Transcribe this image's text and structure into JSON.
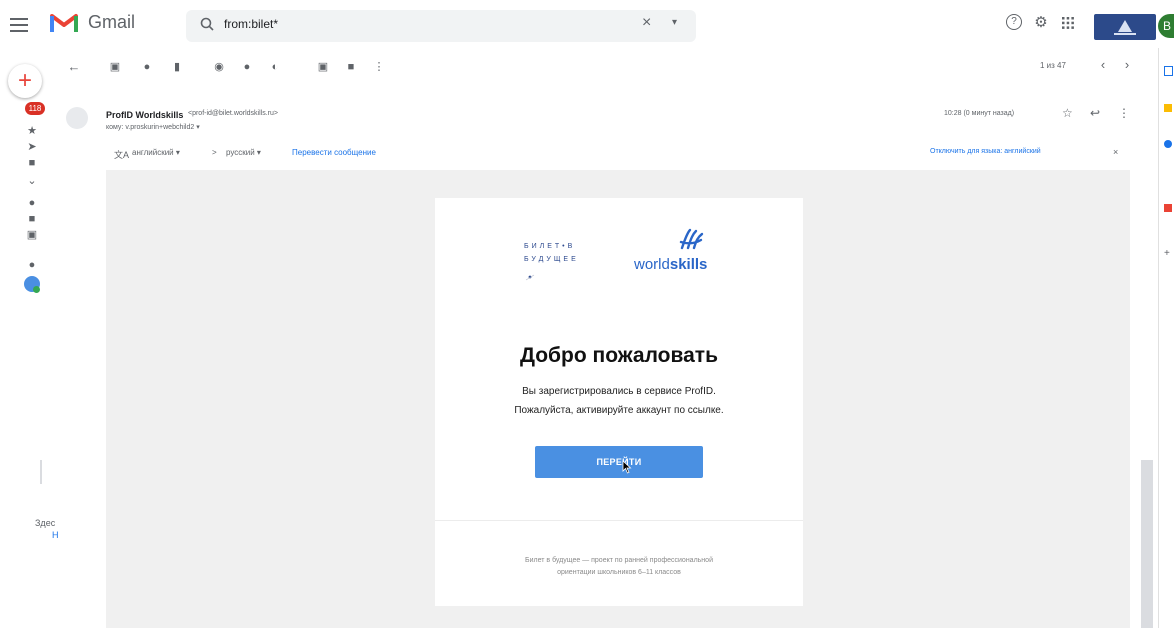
{
  "header": {
    "app_name": "Gmail",
    "search_value": "from:bilet*",
    "clear_glyph": "×",
    "options_glyph": "▾",
    "help_glyph": "?",
    "settings_glyph": "⚙",
    "apps_glyph": "⋮⋮⋮",
    "avatar_letter": "B"
  },
  "left_rail": {
    "compose_glyph": "+",
    "unread_count": "118",
    "footer_text": "Здес",
    "footer_link": "Н"
  },
  "toolbar": {
    "back_glyph": "←",
    "pager": "1 из 47",
    "prev_glyph": "‹",
    "next_glyph": "›"
  },
  "message": {
    "sender_name": "ProfID Worldskills",
    "sender_email": "<prof-id@bilet.worldskills.ru>",
    "to_line": "кому: v.proskurin+webchild2 ▾",
    "time": "10:28 (0 минут назад)",
    "star_glyph": "☆",
    "reply_glyph": "↩",
    "more_glyph": "⋮"
  },
  "translate": {
    "icon": "文A",
    "from_lang": "английский ▾",
    "arrow": ">",
    "to_lang": "русский ▾",
    "translate_link": "Перевести сообщение",
    "disable_link": "Отключить для языка: английский",
    "close_glyph": "×"
  },
  "email": {
    "bilet_logo_line1": "БИЛЕТ•В",
    "bilet_logo_line2": "БУДУЩЕЕ",
    "ws_logo_prefix": "world",
    "ws_logo_suffix": "skills",
    "title": "Добро пожаловать",
    "line1": "Вы зарегистрировались в сервисе ProfID.",
    "line2": "Пожалуйста, активируйте аккаунт по ссылке.",
    "button": "ПЕРЕЙТИ",
    "footer_line1": "Билет в будущее — проект по ранней профессиональной",
    "footer_line2": "ориентации школьников 6–11 классов"
  },
  "colors": {
    "accent": "#1a73e8",
    "button": "#4a90e2",
    "badge": "#d93025",
    "gmail_red": "#ea4335"
  }
}
